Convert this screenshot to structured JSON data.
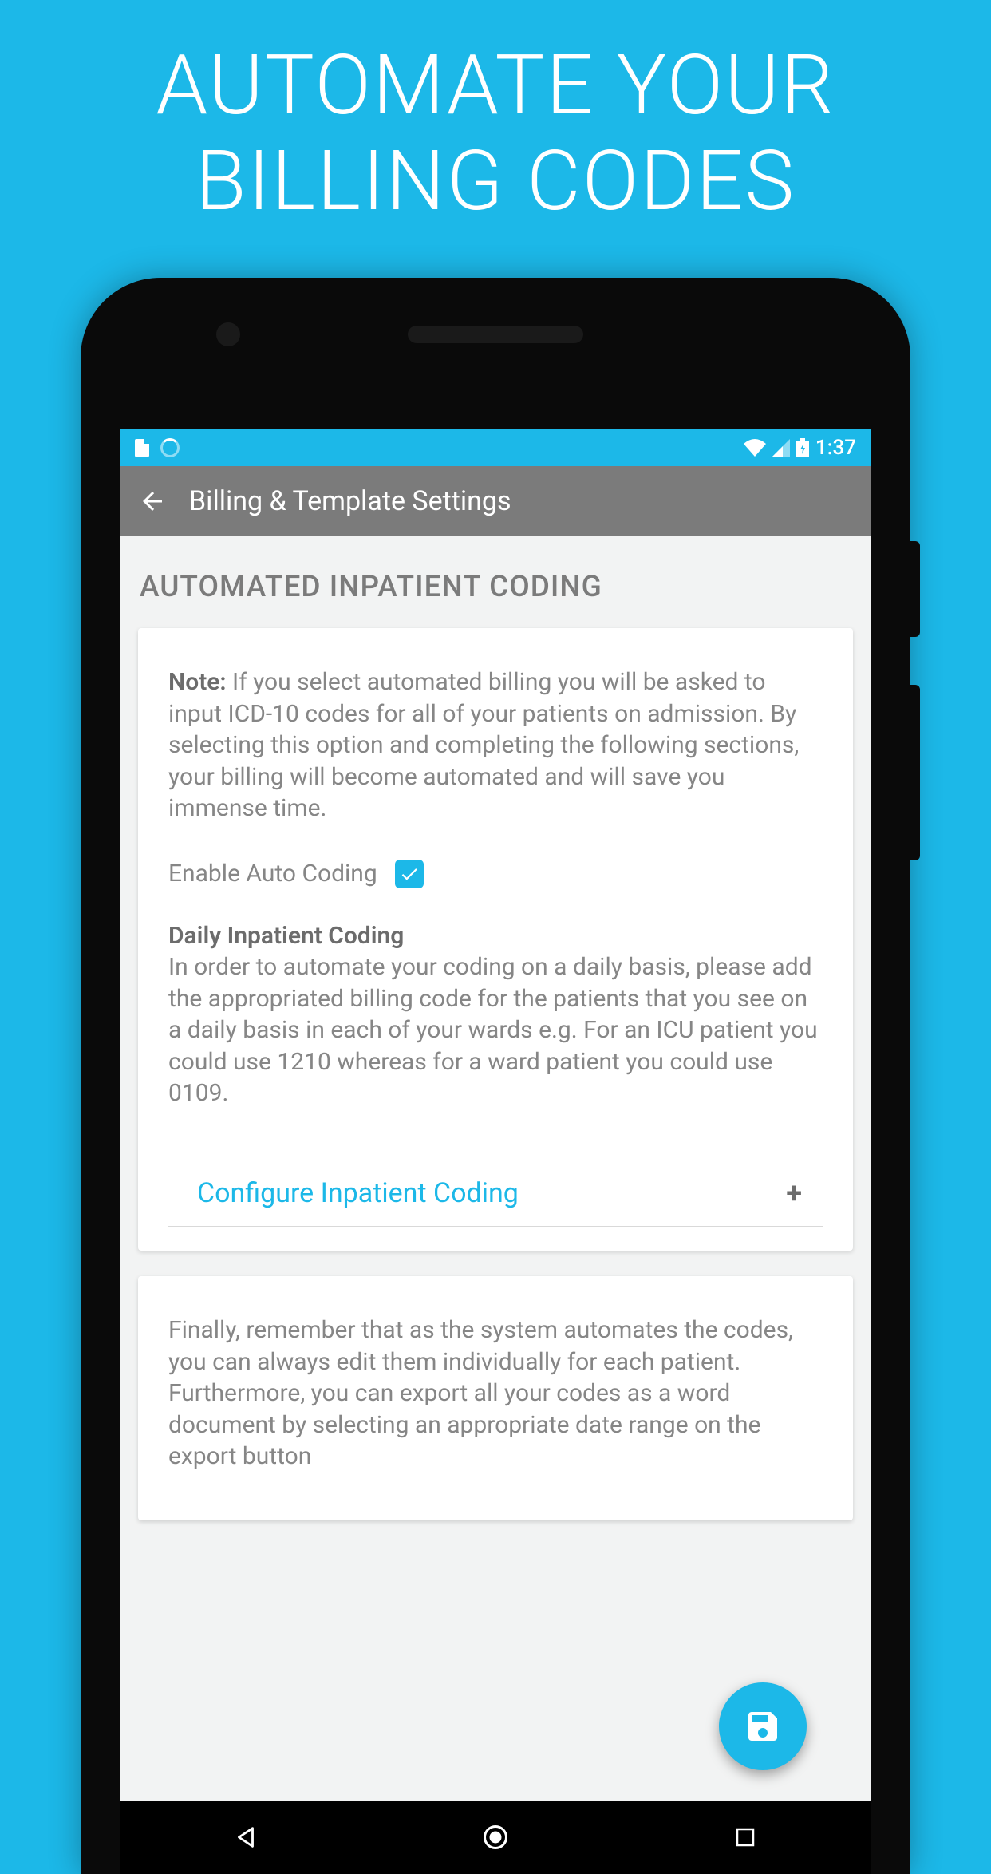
{
  "promo": {
    "line1": "AUTOMATE YOUR",
    "line2": "BILLING CODES"
  },
  "status_bar": {
    "time": "1:37"
  },
  "app_bar": {
    "title": "Billing & Template Settings"
  },
  "section": {
    "heading": "AUTOMATED INPATIENT CODING"
  },
  "card1": {
    "note_label": "Note:",
    "note_body": " If you select automated billing you will be asked to input ICD-10 codes for all of your patients on admission. By selecting this option and completing the following sections, your billing will become automated and will save you immense time.",
    "checkbox_label": "Enable Auto Coding",
    "checkbox_checked": true,
    "sub_heading": "Daily Inpatient Coding",
    "sub_body": "In order to automate your coding on a daily basis, please add the appropriated billing code for the patients that you see on a daily basis in each of your wards e.g. For an ICU patient you could use 1210 whereas for a ward patient you could use 0109.",
    "configure_label": "Configure Inpatient Coding"
  },
  "card2": {
    "body": "Finally, remember that as the system automates the codes, you can always edit them individually for each patient. Furthermore, you can export all your codes as a word document by selecting an appropriate date range on the export button"
  }
}
